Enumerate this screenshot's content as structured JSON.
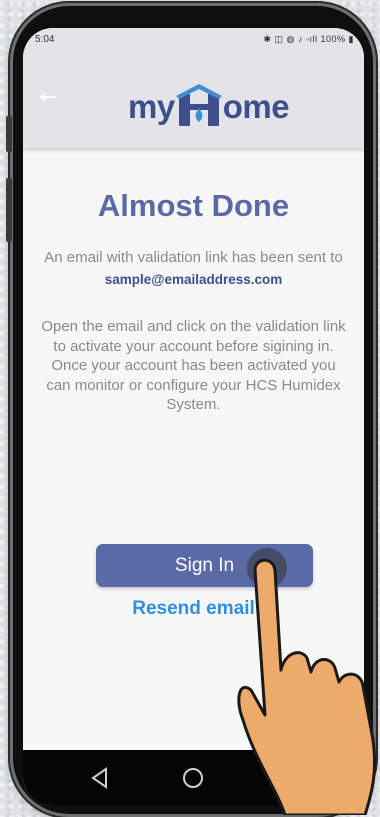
{
  "status_bar": {
    "time": "5:04",
    "icons": "✱ ◫ ◍ ♪ ◦ıll 100% ▮"
  },
  "app_bar": {
    "back_icon": "arrow-left-icon",
    "logo_left": "my",
    "logo_right": "ome"
  },
  "main": {
    "title": "Almost Done",
    "message": "An email with validation link has been sent to",
    "email": "sample@emailaddress.com",
    "instructions_1": "Open the email and click on the validation link to activate your account before sigining in.",
    "instructions_2": "Once your account has been activated you can monitor or configure your HCS Humidex System."
  },
  "actions": {
    "sign_in_label": "Sign In",
    "resend_label": "Resend email"
  },
  "nav": {
    "icons": [
      "back-triangle-icon",
      "home-circle-icon",
      "recents-square-icon"
    ]
  },
  "colors": {
    "brand": "#3d4f8d",
    "button": "#5a6aa6",
    "link": "#2f8fe0"
  }
}
